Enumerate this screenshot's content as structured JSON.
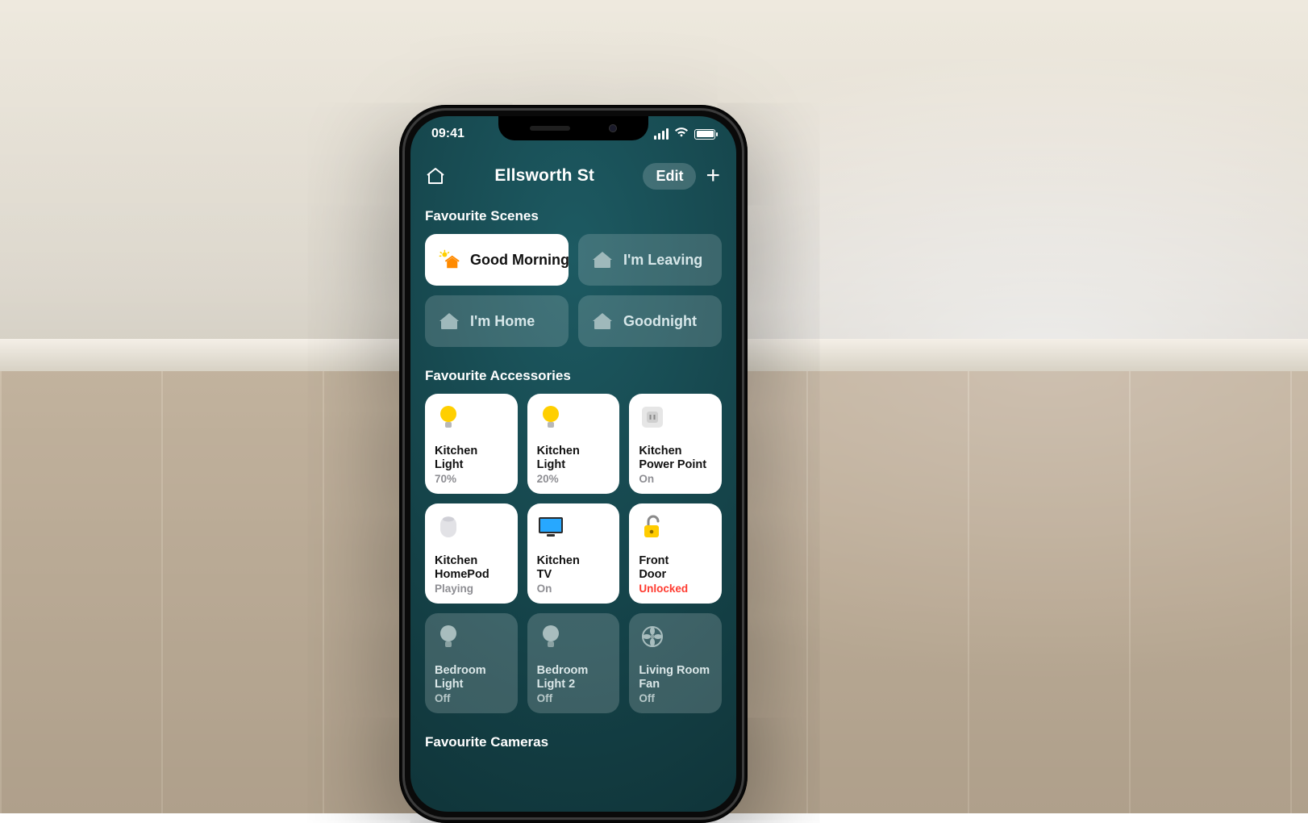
{
  "status": {
    "time": "09:41"
  },
  "nav": {
    "home_title": "Ellsworth St",
    "edit_label": "Edit"
  },
  "sections": {
    "scenes_title": "Favourite Scenes",
    "accessories_title": "Favourite Accessories",
    "cameras_title": "Favourite Cameras"
  },
  "scenes": [
    {
      "label": "Good Morning",
      "icon": "sunrise-house",
      "active": true
    },
    {
      "label": "I'm Leaving",
      "icon": "person-leaving-house",
      "active": false
    },
    {
      "label": "I'm Home",
      "icon": "person-arriving-house",
      "active": false
    },
    {
      "label": "Goodnight",
      "icon": "moon-house",
      "active": false
    }
  ],
  "accessories": [
    {
      "line1": "Kitchen",
      "line2": "Light",
      "status": "70%",
      "icon": "bulb-on",
      "active": true,
      "status_color": "gray"
    },
    {
      "line1": "Kitchen",
      "line2": "Light",
      "status": "20%",
      "icon": "bulb-on",
      "active": true,
      "status_color": "gray"
    },
    {
      "line1": "Kitchen",
      "line2": "Power Point",
      "status": "On",
      "icon": "outlet",
      "active": true,
      "status_color": "gray"
    },
    {
      "line1": "Kitchen",
      "line2": "HomePod",
      "status": "Playing",
      "icon": "homepod",
      "active": true,
      "status_color": "gray"
    },
    {
      "line1": "Kitchen",
      "line2": "TV",
      "status": "On",
      "icon": "tv",
      "active": true,
      "status_color": "gray"
    },
    {
      "line1": "Front",
      "line2": "Door",
      "status": "Unlocked",
      "icon": "lock-open",
      "active": true,
      "status_color": "red"
    },
    {
      "line1": "Bedroom",
      "line2": "Light",
      "status": "Off",
      "icon": "bulb-off",
      "active": false,
      "status_color": "gray"
    },
    {
      "line1": "Bedroom",
      "line2": "Light 2",
      "status": "Off",
      "icon": "bulb-off",
      "active": false,
      "status_color": "gray"
    },
    {
      "line1": "Living Room",
      "line2": "Fan",
      "status": "Off",
      "icon": "fan",
      "active": false,
      "status_color": "gray"
    }
  ],
  "colors": {
    "accent_orange": "#ff8a00",
    "bulb_yellow": "#ffcf00",
    "tv_blue": "#27a8ff",
    "lock_yellow": "#ffcc00",
    "status_red": "#ff3b30"
  }
}
